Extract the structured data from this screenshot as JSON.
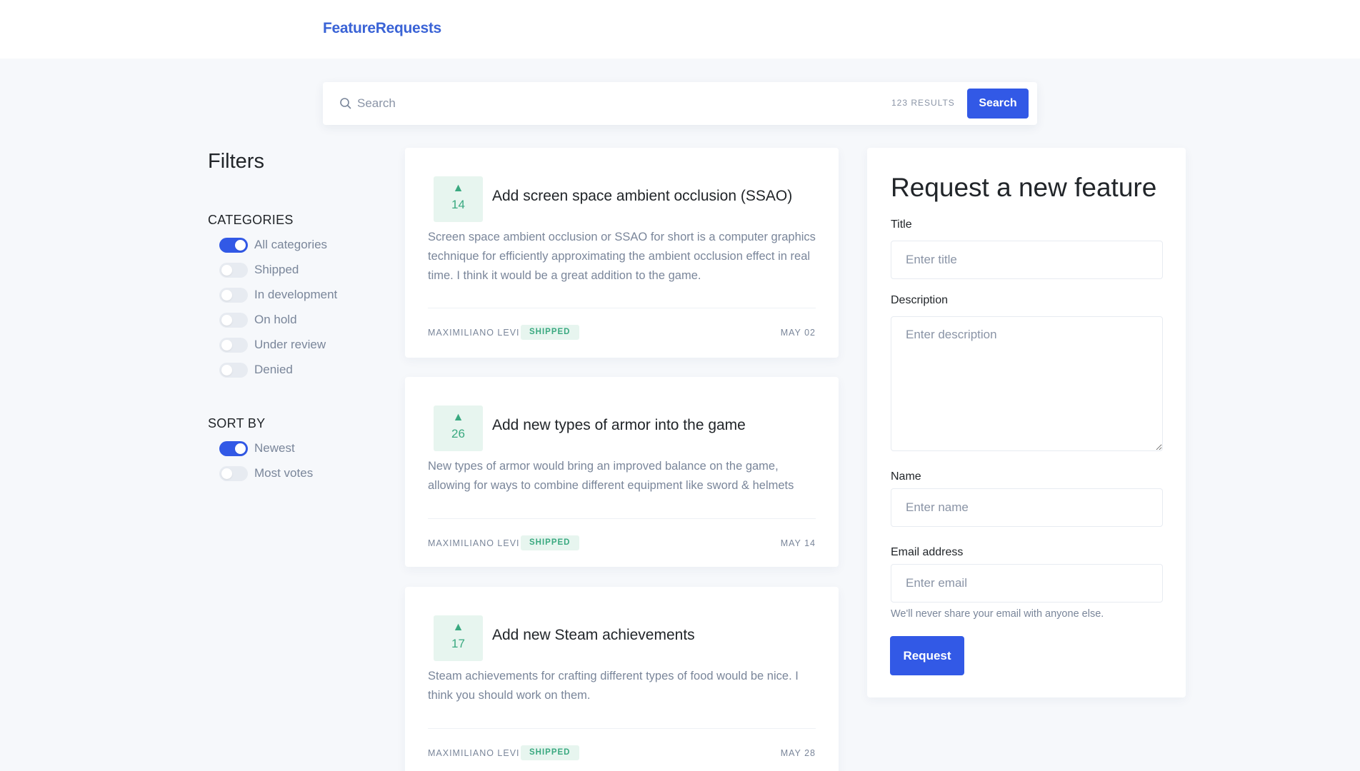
{
  "app": {
    "brand": "FeatureRequests"
  },
  "search": {
    "placeholder": "Search",
    "value": "",
    "results_count": "123 RESULTS",
    "button_label": "Search"
  },
  "filters": {
    "title": "Filters",
    "categories": {
      "title": "CATEGORIES",
      "items": [
        {
          "label": "All categories",
          "checked": true
        },
        {
          "label": "Shipped",
          "checked": false
        },
        {
          "label": "In development",
          "checked": false
        },
        {
          "label": "On hold",
          "checked": false
        },
        {
          "label": "Under review",
          "checked": false
        },
        {
          "label": "Denied",
          "checked": false
        }
      ]
    },
    "sort_by": {
      "title": "SORT BY",
      "items": [
        {
          "label": "Newest",
          "checked": true
        },
        {
          "label": "Most votes",
          "checked": false
        }
      ]
    }
  },
  "feature_requests": [
    {
      "votes": "14",
      "title": "Add screen space ambient occlusion (SSAO)",
      "description": "Screen space ambient occlusion or SSAO for short is a computer graphics technique for efficiently approximating the ambient occlusion effect in real time. I think it would be a great addition to the game.",
      "author": "MAXIMILIANO LEVI",
      "status": "SHIPPED",
      "date": "MAY 02"
    },
    {
      "votes": "26",
      "title": "Add new types of armor into the game",
      "description": "New types of armor would bring an improved balance on the game, allowing for ways to combine different equipment like sword & helmets",
      "author": "MAXIMILIANO LEVI",
      "status": "SHIPPED",
      "date": "MAY 14"
    },
    {
      "votes": "17",
      "title": "Add new Steam achievements",
      "description": "Steam achievements for crafting different types of food would be nice. I think you should work on them.",
      "author": "MAXIMILIANO LEVI",
      "status": "SHIPPED",
      "date": "MAY 28"
    }
  ],
  "request_form": {
    "title": "Request a new feature",
    "title_label": "Title",
    "title_placeholder": "Enter title",
    "description_label": "Description",
    "description_placeholder": "Enter description",
    "name_label": "Name",
    "name_placeholder": "Enter name",
    "email_label": "Email address",
    "email_placeholder": "Enter email",
    "email_help": "We'll never share your email with anyone else.",
    "submit_label": "Request"
  },
  "colors": {
    "primary": "#3259e6",
    "brand": "#3a63d6",
    "success": "#3aa980",
    "success_bg": "#e7f5ef",
    "background": "#f6f8fb"
  }
}
